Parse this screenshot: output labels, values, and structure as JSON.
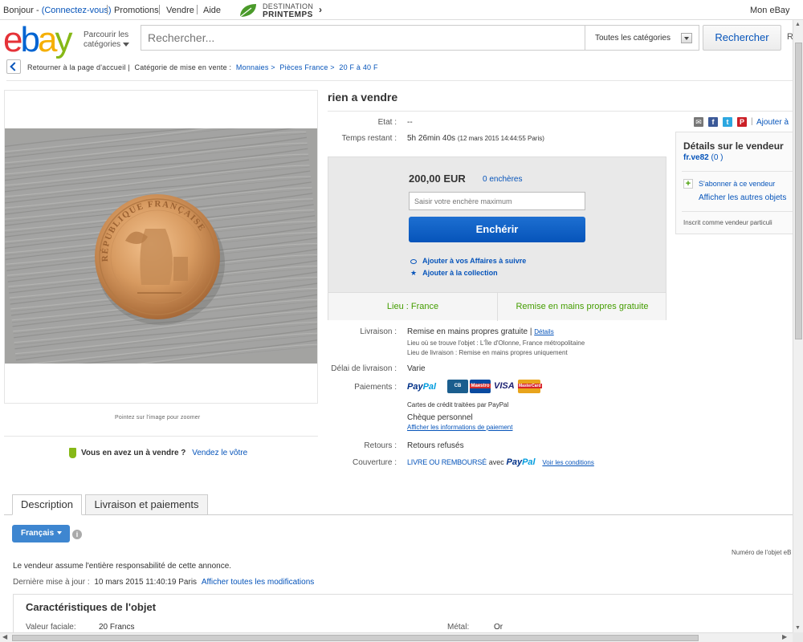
{
  "topnav": {
    "greeting": "Bonjour",
    "connect": "(Connectez-vous)",
    "promotions": "Promotions",
    "sell": "Vendre",
    "help": "Aide",
    "promo_line1": "DESTINATION",
    "promo_line2": "PRINTEMPS",
    "my_ebay": "Mon eBay"
  },
  "header": {
    "browse_line1": "Parcourir les",
    "browse_line2": "catégories",
    "search_placeholder": "Rechercher...",
    "category": "Toutes les catégories",
    "search_button": "Rechercher",
    "edge_letter": "R"
  },
  "breadcrumb": {
    "back": "Retourner à la page d'accueil",
    "sep": "|",
    "category_label": "Catégorie de mise en vente :",
    "items": [
      "Monnaies",
      "Pièces France",
      "20 F à 40 F"
    ],
    "arrow": ">"
  },
  "image": {
    "zoom_hint": "Pointez sur l'image pour zoomer",
    "coin_legend": "RÉPUBLIQUE FRANÇAISE",
    "sell_question": "Vous en avez un à vendre ?",
    "sell_link": "Vendez le vôtre"
  },
  "item": {
    "title": "rien a vendre",
    "condition_label": "Etat :",
    "condition_value": "--",
    "time_label": "Temps restant :",
    "time_value": "5h 26min 40s",
    "time_date": "(12 mars 2015   14:44:55 Paris)",
    "price": "200,00 EUR",
    "bids": "0 enchères",
    "bid_placeholder": "Saisir votre enchère maximum",
    "bid_button": "Enchérir",
    "watch": "Ajouter à vos Affaires à suivre",
    "collection": "Ajouter à la collection",
    "location": "Lieu : France",
    "pickup": "Remise en mains propres gratuite"
  },
  "shipping": {
    "label": "Livraison :",
    "value": "Remise en mains propres gratuite |",
    "details_link": "Détails",
    "location_line": "Lieu où se trouve l'objet : L'Île d'Olonne, France métropolitaine",
    "delivery_line": "Lieu de livraison : Remise en mains propres uniquement",
    "delay_label": "Délai de livraison :",
    "delay_value": "Varie"
  },
  "payments": {
    "label": "Paiements :",
    "paypal_a": "Pay",
    "paypal_b": "Pal",
    "cards": [
      "CB",
      "Maestro",
      "VISA",
      "MasterCard"
    ],
    "cards_note": "Cartes de crédit traitées par PayPal",
    "cheque": "Chèque personnel",
    "info_link": "Afficher les informations de paiement"
  },
  "returns": {
    "label": "Retours :",
    "value": "Retours refusés"
  },
  "coverage": {
    "label": "Couverture :",
    "text": "LIVRE OU REMBOURSÉ",
    "with": "avec",
    "paypal_a": "Pay",
    "paypal_b": "Pal",
    "link": "Voir les conditions"
  },
  "share": {
    "icons": [
      "mail",
      "f",
      "t",
      "P"
    ],
    "add_link": "Ajouter à"
  },
  "seller": {
    "heading": "Détails sur le vendeur",
    "name": "fr.ve82",
    "score": "(0 )",
    "subscribe": "S'abonner à ce vendeur",
    "other_items": "Afficher les autres objets",
    "since": "Inscrit comme vendeur particuli"
  },
  "tabs": {
    "description": "Description",
    "shipping": "Livraison et paiements"
  },
  "description": {
    "language": "Français",
    "info": "i",
    "item_number": "Numéro de l'objet eB",
    "responsibility": "Le vendeur assume l'entière responsabilité de cette annonce.",
    "last_update_label": "Dernière mise à jour :",
    "last_update_value": "10 mars 2015 11:40:19 Paris",
    "modifications_link": "Afficher toutes les modifications"
  },
  "specs": {
    "heading": "Caractéristiques de l'objet",
    "face_value_label": "Valeur faciale:",
    "face_value": "20 Francs",
    "metal_label": "Métal:",
    "metal": "Or"
  },
  "colors": {
    "link": "#0654ba",
    "bid_button": "#0654ba",
    "green": "#449d00",
    "logo_e": "#e53238",
    "logo_b": "#0064d2",
    "logo_a": "#f5af02",
    "logo_y": "#86b817"
  }
}
